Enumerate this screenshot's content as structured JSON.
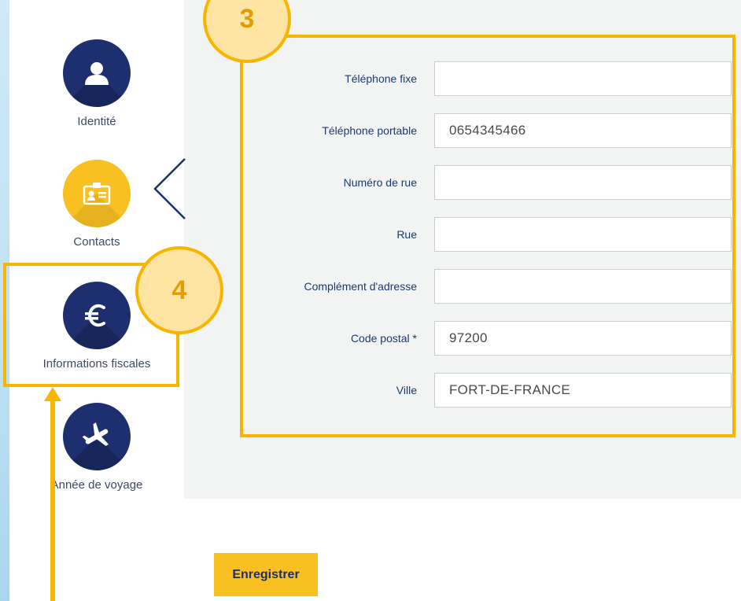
{
  "sidebar": {
    "items": [
      {
        "label": "Identité",
        "icon": "user-icon"
      },
      {
        "label": "Contacts",
        "icon": "id-card-icon"
      },
      {
        "label": "Informations fiscales",
        "icon": "euro-icon"
      },
      {
        "label": "Année de voyage",
        "icon": "airplane-icon"
      }
    ]
  },
  "form": {
    "fields": [
      {
        "label": "Téléphone fixe",
        "value": ""
      },
      {
        "label": "Téléphone portable",
        "value": "0654345466"
      },
      {
        "label": "Numéro de rue",
        "value": ""
      },
      {
        "label": "Rue",
        "value": ""
      },
      {
        "label": "Complément d'adresse",
        "value": ""
      },
      {
        "label": "Code postal *",
        "value": "97200"
      },
      {
        "label": "Ville",
        "value": "FORT-DE-FRANCE"
      }
    ]
  },
  "actions": {
    "save_label": "Enregistrer"
  },
  "annotations": {
    "badge_form": "3",
    "badge_nav": "4"
  },
  "colors": {
    "accent": "#f9c021",
    "navy": "#1d2f6e",
    "annotation": "#f7b500"
  }
}
